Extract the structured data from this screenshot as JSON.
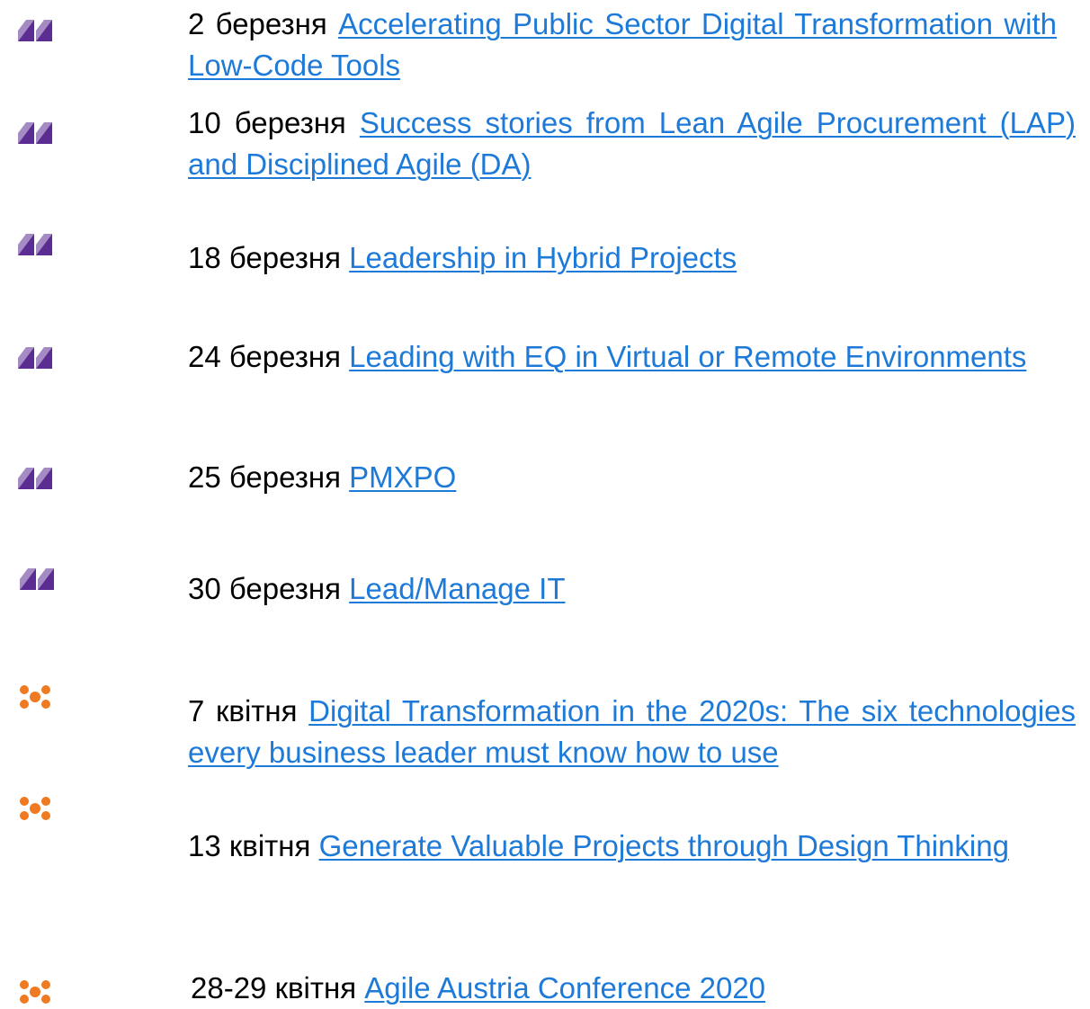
{
  "colors": {
    "purple_icon": "#5b2c91",
    "orange_icon": "#f07a22",
    "link": "#1d7ad8",
    "text": "#000000"
  },
  "events": [
    {
      "date": "2 березня",
      "title": "Accelerating Public Sector Digital Transformation with Low-Code Tools",
      "icon": "purple-triangles-icon"
    },
    {
      "date": "10 березня",
      "title": "Success stories from Lean Agile Procurement (LAP) and Disciplined Agile (DA)",
      "icon": "purple-triangles-icon"
    },
    {
      "date": "18 березня",
      "title": "Leadership in Hybrid Projects",
      "icon": "purple-triangles-icon"
    },
    {
      "date": "24 березня",
      "title": "Leading with EQ in Virtual or Remote Environments",
      "icon": "purple-triangles-icon"
    },
    {
      "date": "25 березня",
      "title": "PMXPO",
      "icon": "purple-triangles-icon"
    },
    {
      "date": "30 березня",
      "title": "Lead/Manage IT",
      "icon": "purple-triangles-icon"
    },
    {
      "date": "7 квітня",
      "title": "Digital Transformation in the 2020s: The six technologies every business leader must know how to use",
      "icon": "orange-dots-icon"
    },
    {
      "date": "13 квітня",
      "title": "Generate Valuable Projects through Design Thinking",
      "icon": "orange-dots-icon"
    },
    {
      "date": "28-29 квітня",
      "title": "Agile Austria Conference 2020",
      "icon": "orange-dots-icon"
    }
  ]
}
